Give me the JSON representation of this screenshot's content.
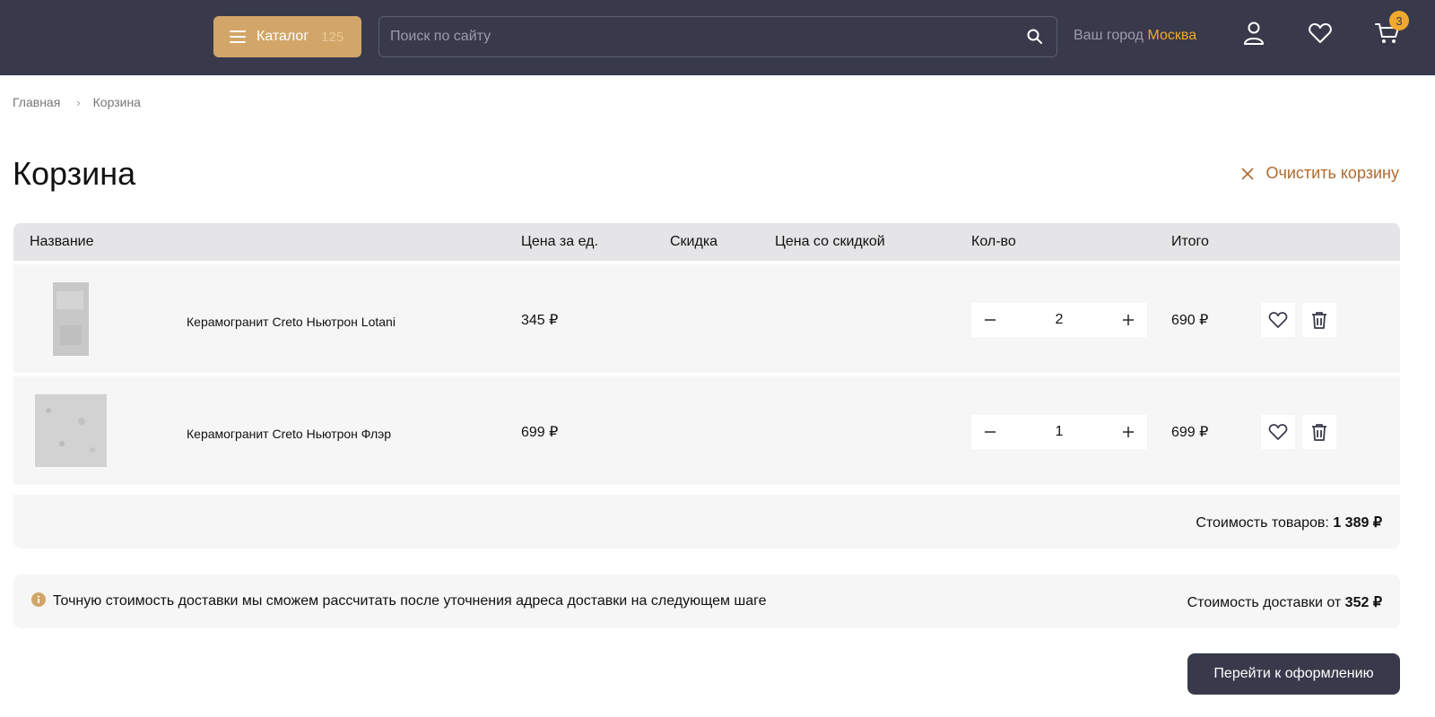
{
  "header": {
    "catalog_label": "Каталог",
    "catalog_count": "125",
    "search_placeholder": "Поиск по сайту",
    "city_prefix": "Ваш город",
    "city_name": "Москва",
    "cart_count": "3",
    "icons": [
      "menu-icon",
      "search-icon",
      "user-icon",
      "heart-icon",
      "cart-icon"
    ],
    "colors": {
      "bg": "#383a4c",
      "accent": "#d2a668",
      "city": "#f0a82f"
    }
  },
  "breadcrumb": {
    "home": "Главная",
    "current": "Корзина"
  },
  "page": {
    "title": "Корзина",
    "clear_label": "Очистить корзину"
  },
  "table": {
    "headers": {
      "name": "Название",
      "unit_price": "Цена за ед.",
      "discount": "Скидка",
      "discount_price": "Цена со скидкой",
      "qty": "Кол-во",
      "total": "Итого"
    },
    "rows": [
      {
        "name": "Керамогранит Creto Ньютрон Lotani",
        "price": "345 ₽",
        "qty": "2",
        "total": "690 ₽"
      },
      {
        "name": "Керамогранит Creto Ньютрон Флэр",
        "price": "699 ₽",
        "qty": "1",
        "total": "699 ₽"
      }
    ]
  },
  "summary": {
    "label": "Стоимость товаров:",
    "value": "1 389 ₽"
  },
  "delivery": {
    "note": "Точную стоимость доставки мы сможем рассчитать после уточнения адреса доставки на следующем шаге",
    "label": "Стоимость доставки от",
    "value": "352 ₽"
  },
  "checkout_label": "Перейти к оформлению"
}
